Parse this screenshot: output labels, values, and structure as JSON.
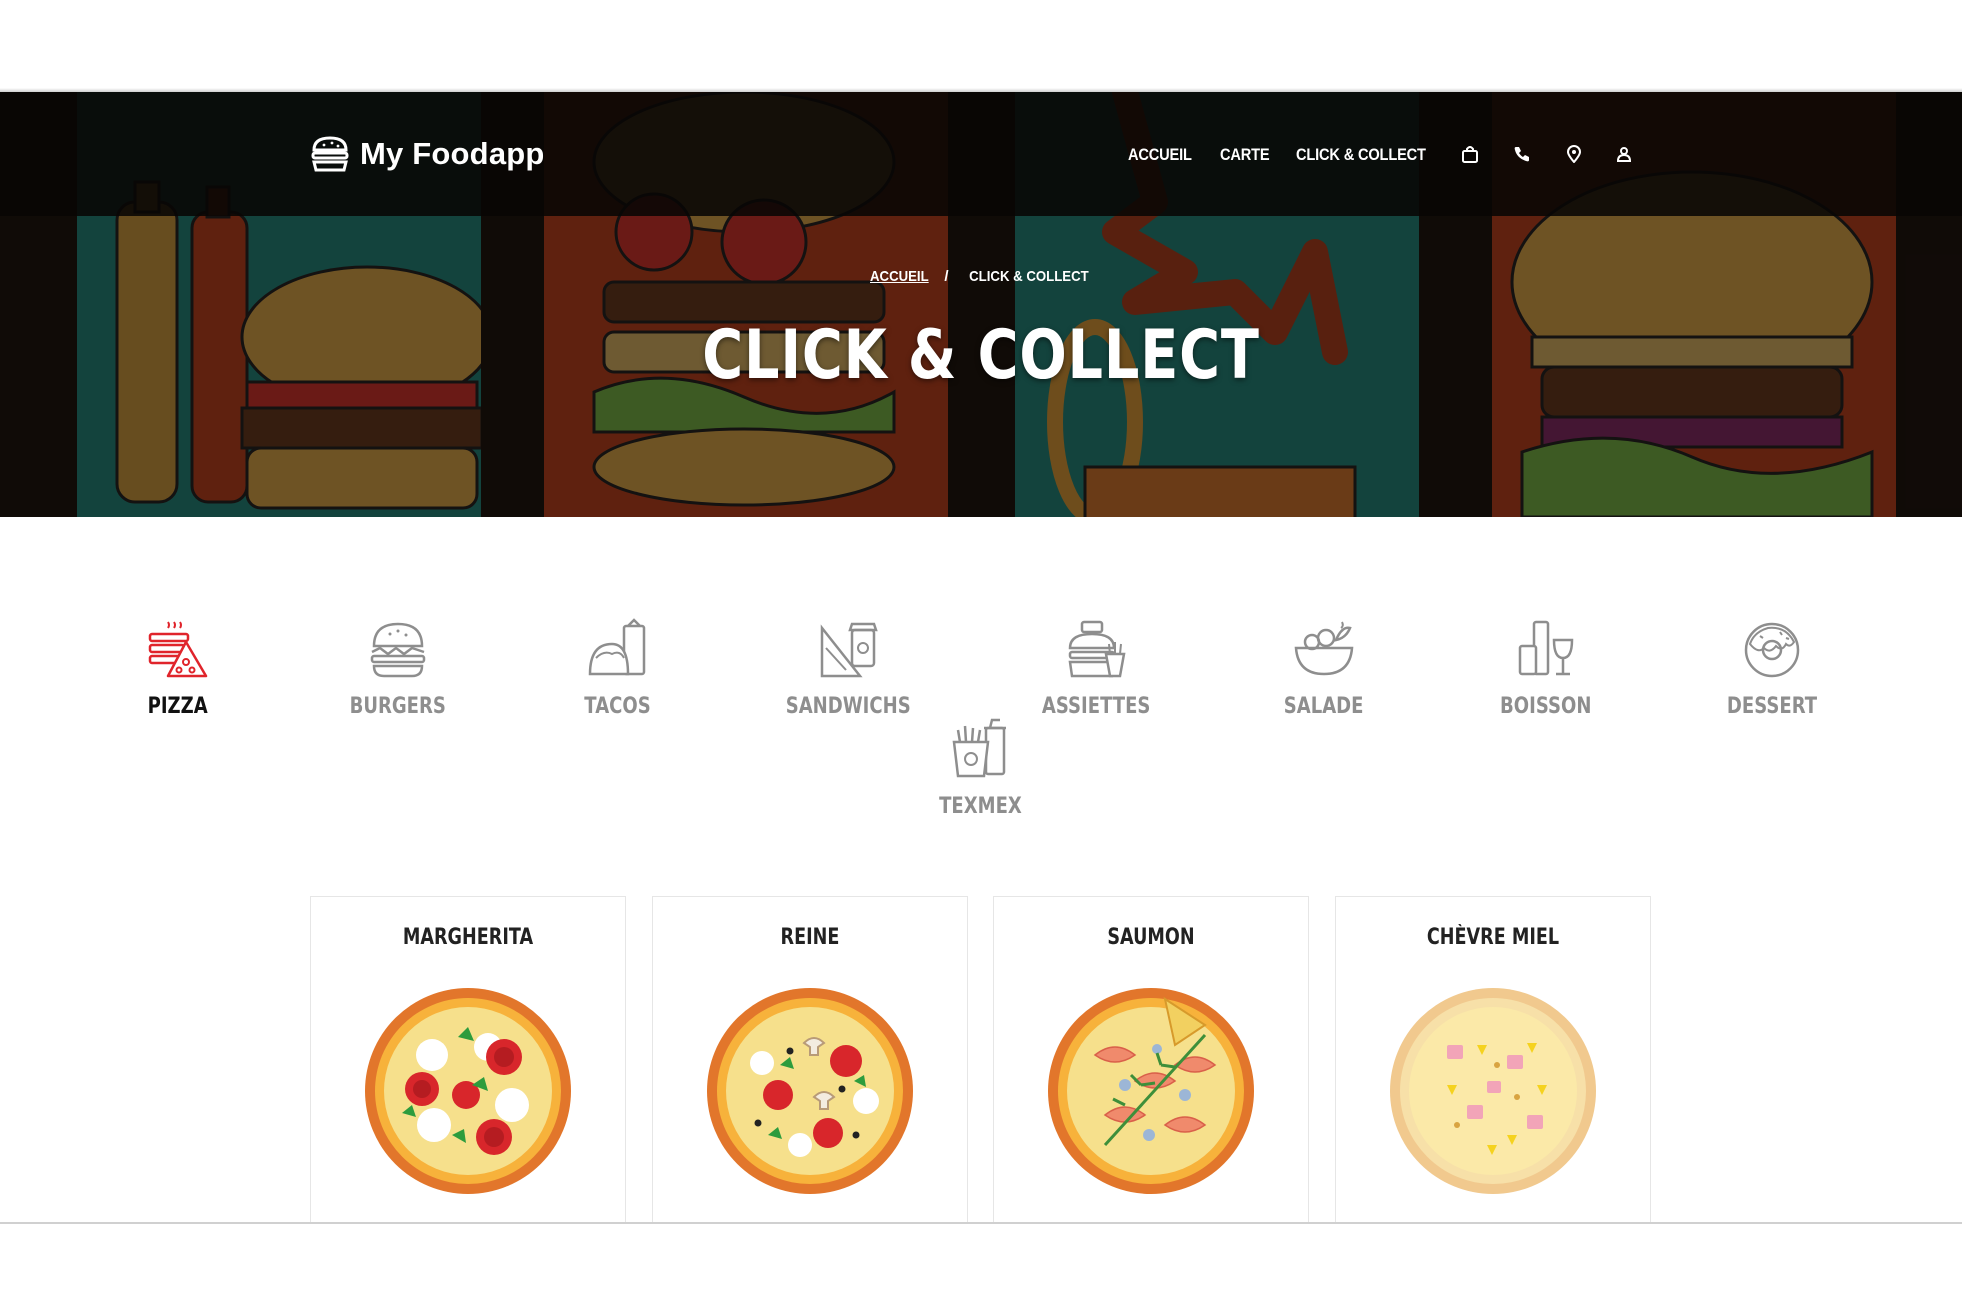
{
  "app": {
    "name": "My Foodapp"
  },
  "nav": {
    "items": [
      "ACCUEIL",
      "CARTE",
      "CLICK & COLLECT"
    ],
    "icons": [
      "shopping-bag-icon",
      "phone-icon",
      "location-pin-icon",
      "user-icon"
    ]
  },
  "hero": {
    "breadcrumb_home": "ACCUEIL",
    "breadcrumb_sep": "/",
    "breadcrumb_current": "CLICK & COLLECT",
    "title": "CLICK & COLLECT"
  },
  "categories": [
    {
      "label": "PIZZA",
      "icon": "pizza-icon",
      "active": true
    },
    {
      "label": "BURGERS",
      "icon": "burger-icon",
      "active": false
    },
    {
      "label": "TACOS",
      "icon": "taco-icon",
      "active": false
    },
    {
      "label": "SANDWICHS",
      "icon": "sandwich-icon",
      "active": false
    },
    {
      "label": "ASSIETTES",
      "icon": "meal-plate-icon",
      "active": false
    },
    {
      "label": "SALADE",
      "icon": "salad-bowl-icon",
      "active": false
    },
    {
      "label": "BOISSON",
      "icon": "drinks-icon",
      "active": false
    },
    {
      "label": "DESSERT",
      "icon": "donut-icon",
      "active": false
    },
    {
      "label": "TEXMEX",
      "icon": "fries-icon",
      "active": false
    }
  ],
  "products": [
    {
      "name": "MARGHERITA",
      "image": "pizza-margherita"
    },
    {
      "name": "REINE",
      "image": "pizza-reine"
    },
    {
      "name": "SAUMON",
      "image": "pizza-saumon"
    },
    {
      "name": "CHÈVRE MIEL",
      "image": "pizza-chevre-miel"
    }
  ],
  "colors": {
    "accent": "#e0242b",
    "inactive": "#8e8e8e",
    "active": "#111111"
  }
}
